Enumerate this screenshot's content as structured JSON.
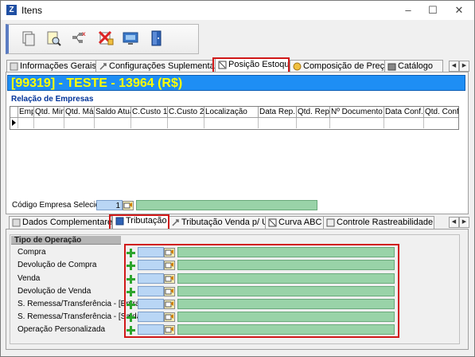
{
  "window": {
    "title": "Itens"
  },
  "toolbar": {
    "buttons": [
      {
        "icon": "copy-document-icon"
      },
      {
        "icon": "search-document-icon"
      },
      {
        "icon": "tree-delete-icon"
      },
      {
        "icon": "edit-delete-icon"
      },
      {
        "icon": "monitor-icon"
      },
      {
        "icon": "exit-door-icon"
      }
    ]
  },
  "top_tabs": [
    {
      "label": "Informações Gerais"
    },
    {
      "label": "Configurações Suplementares"
    },
    {
      "label": "Posição Estoque"
    },
    {
      "label": "Composição de Preços"
    },
    {
      "label": "Catálogo"
    }
  ],
  "item_header": "[99319] - TESTE - 13964 (R$)",
  "relacao": {
    "title": "Relação de Empresas",
    "columns": [
      "Emp",
      "Qtd. Min.",
      "Qtd. Máx.",
      "Saldo Atual",
      "C.Custo 1",
      "C.Custo 2",
      "Localização",
      "Data Rep.",
      "Qtd. Rep.",
      "Nº Documento",
      "Data Conf.",
      "Qtd. Conf."
    ]
  },
  "empresa_selecionada": {
    "label": "Código Empresa Selecionada",
    "value": "1"
  },
  "bottom_tabs": [
    {
      "label": "Dados Complementares"
    },
    {
      "label": "Tributação"
    },
    {
      "label": "Tributação Venda p/ UF"
    },
    {
      "label": "Curva ABC"
    },
    {
      "label": "Controle Rastreabilidade"
    }
  ],
  "tipo_operacao": {
    "title": "Tipo de Operação",
    "rows": [
      {
        "label": "Compra"
      },
      {
        "label": "Devolução de Compra"
      },
      {
        "label": "Venda"
      },
      {
        "label": "Devolução de Venda"
      },
      {
        "label": "S. Remessa/Transferência - [Entrada]"
      },
      {
        "label": "S. Remessa/Transferência - [Saida]"
      },
      {
        "label": "Operação Personalizada"
      }
    ]
  },
  "colors": {
    "accent": "#1e8ef4",
    "header_text": "#ffff00",
    "highlight": "#d01818",
    "green_field": "#99d3a8",
    "blue_field": "#b9d6f5"
  }
}
